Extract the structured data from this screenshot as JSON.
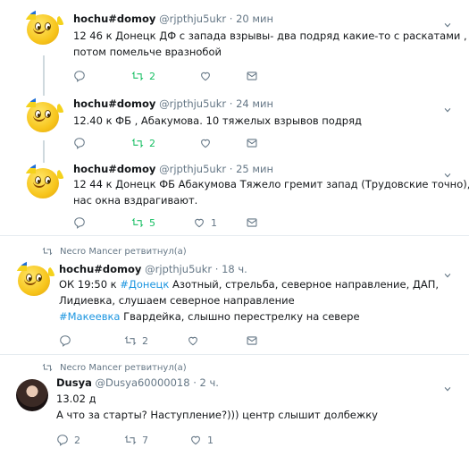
{
  "tweets": [
    {
      "name": "hochu#domoy",
      "handle": "@rjpthju5ukr",
      "dot": "·",
      "time": "20 мин",
      "lines": [
        "12 46 к Донецк ДФ с запада взрывы- два подряд какие-то с раскатами , а",
        "потом помельче вразнобой"
      ],
      "counts": {
        "reply": "",
        "retweet": "2",
        "like": ""
      }
    },
    {
      "name": "hochu#domoy",
      "handle": "@rjpthju5ukr",
      "dot": "·",
      "time": "24 мин",
      "lines": [
        "12.40  к ФБ , Абакумова. 10 тяжелых взрывов подряд"
      ],
      "counts": {
        "reply": "",
        "retweet": "2",
        "like": ""
      }
    },
    {
      "name": "hochu#domoy",
      "handle": "@rjpthju5ukr",
      "dot": "·",
      "time": "25 мин",
      "lines": [
        "12 44 к Донецк ФБ Абакумова  Тяжело гремит запад (Трудовские точно), у",
        "нас окна вздрагивают."
      ],
      "counts": {
        "reply": "",
        "retweet": "5",
        "like": "1"
      }
    },
    {
      "retweeted_by": "Necro Mancer ретвитнул(а)",
      "name": "hochu#domoy",
      "handle": "@rjpthju5ukr",
      "dot": "·",
      "time": "18 ч.",
      "line1_prefix": "ОК 19:50  к ",
      "line1_tag": "#Донецк",
      "line1_suffix": " Азотный, стрельба, северное направление, ДАП,",
      "line2": "Лидиевка, слушаем северное направление",
      "line3_tag": "#Макеевка",
      "line3_suffix": " Гвардейка, слышно перестрелку на севере",
      "counts": {
        "reply": "",
        "retweet": "2",
        "like": ""
      }
    },
    {
      "retweeted_by": "Necro Mancer ретвитнул(а)",
      "name": "Dusya",
      "handle": "@Dusya60000018",
      "dot": "·",
      "time": "2 ч.",
      "lines": [
        "13.02 д",
        "А что за старты? Наступление?))) центр слышит долбежку"
      ],
      "counts": {
        "reply": "2",
        "retweet": "7",
        "like": "1"
      }
    }
  ]
}
